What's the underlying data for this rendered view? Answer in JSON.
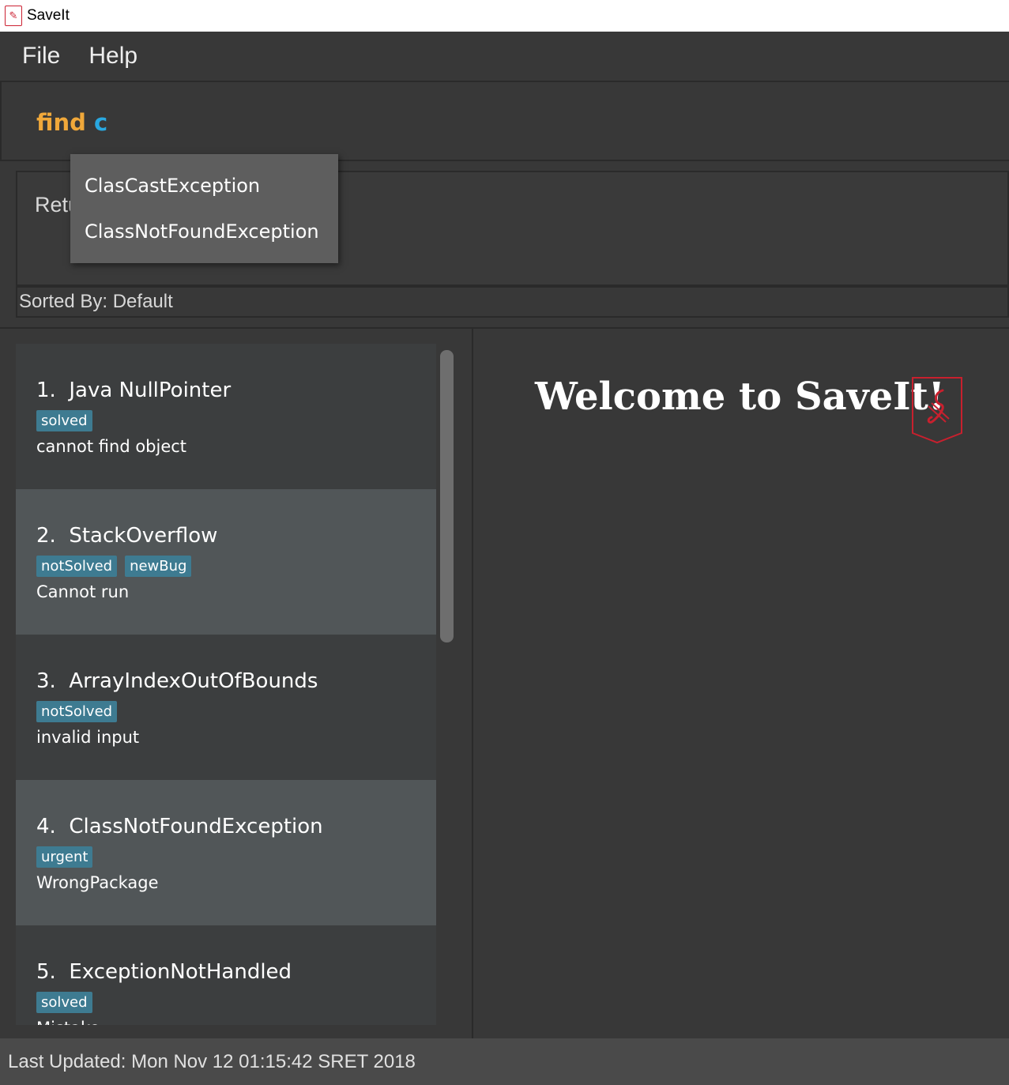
{
  "window": {
    "title": "SaveIt",
    "icon": "saveit-logo-icon"
  },
  "menu": {
    "file": "File",
    "help": "Help"
  },
  "command": {
    "word": "find",
    "arg": "c"
  },
  "autocomplete": {
    "items": [
      "ClasCastException",
      "ClassNotFoundException"
    ]
  },
  "result": {
    "text": "Retu",
    "sorted_by": "Sorted By: Default"
  },
  "issues": [
    {
      "index": "1.",
      "title": "Java NullPointer",
      "tags": [
        "solved"
      ],
      "desc": "cannot find object"
    },
    {
      "index": "2.",
      "title": "StackOverflow",
      "tags": [
        "notSolved",
        "newBug"
      ],
      "desc": "Cannot run"
    },
    {
      "index": "3.",
      "title": "ArrayIndexOutOfBounds",
      "tags": [
        "notSolved"
      ],
      "desc": "invalid input"
    },
    {
      "index": "4.",
      "title": "ClassNotFoundException",
      "tags": [
        "urgent"
      ],
      "desc": "WrongPackage"
    },
    {
      "index": "5.",
      "title": "ExceptionNotHandled",
      "tags": [
        "solved"
      ],
      "desc": "Mistake"
    }
  ],
  "browser": {
    "welcome": "Welcome to SaveIt!"
  },
  "status": {
    "last_updated": "Last Updated: Mon Nov 12 01:15:42 SRET 2018"
  },
  "colors": {
    "command_word": "#f0a83a",
    "command_arg": "#29a8e0",
    "tag": "#3e7b91",
    "logo_red": "#c8202e"
  }
}
